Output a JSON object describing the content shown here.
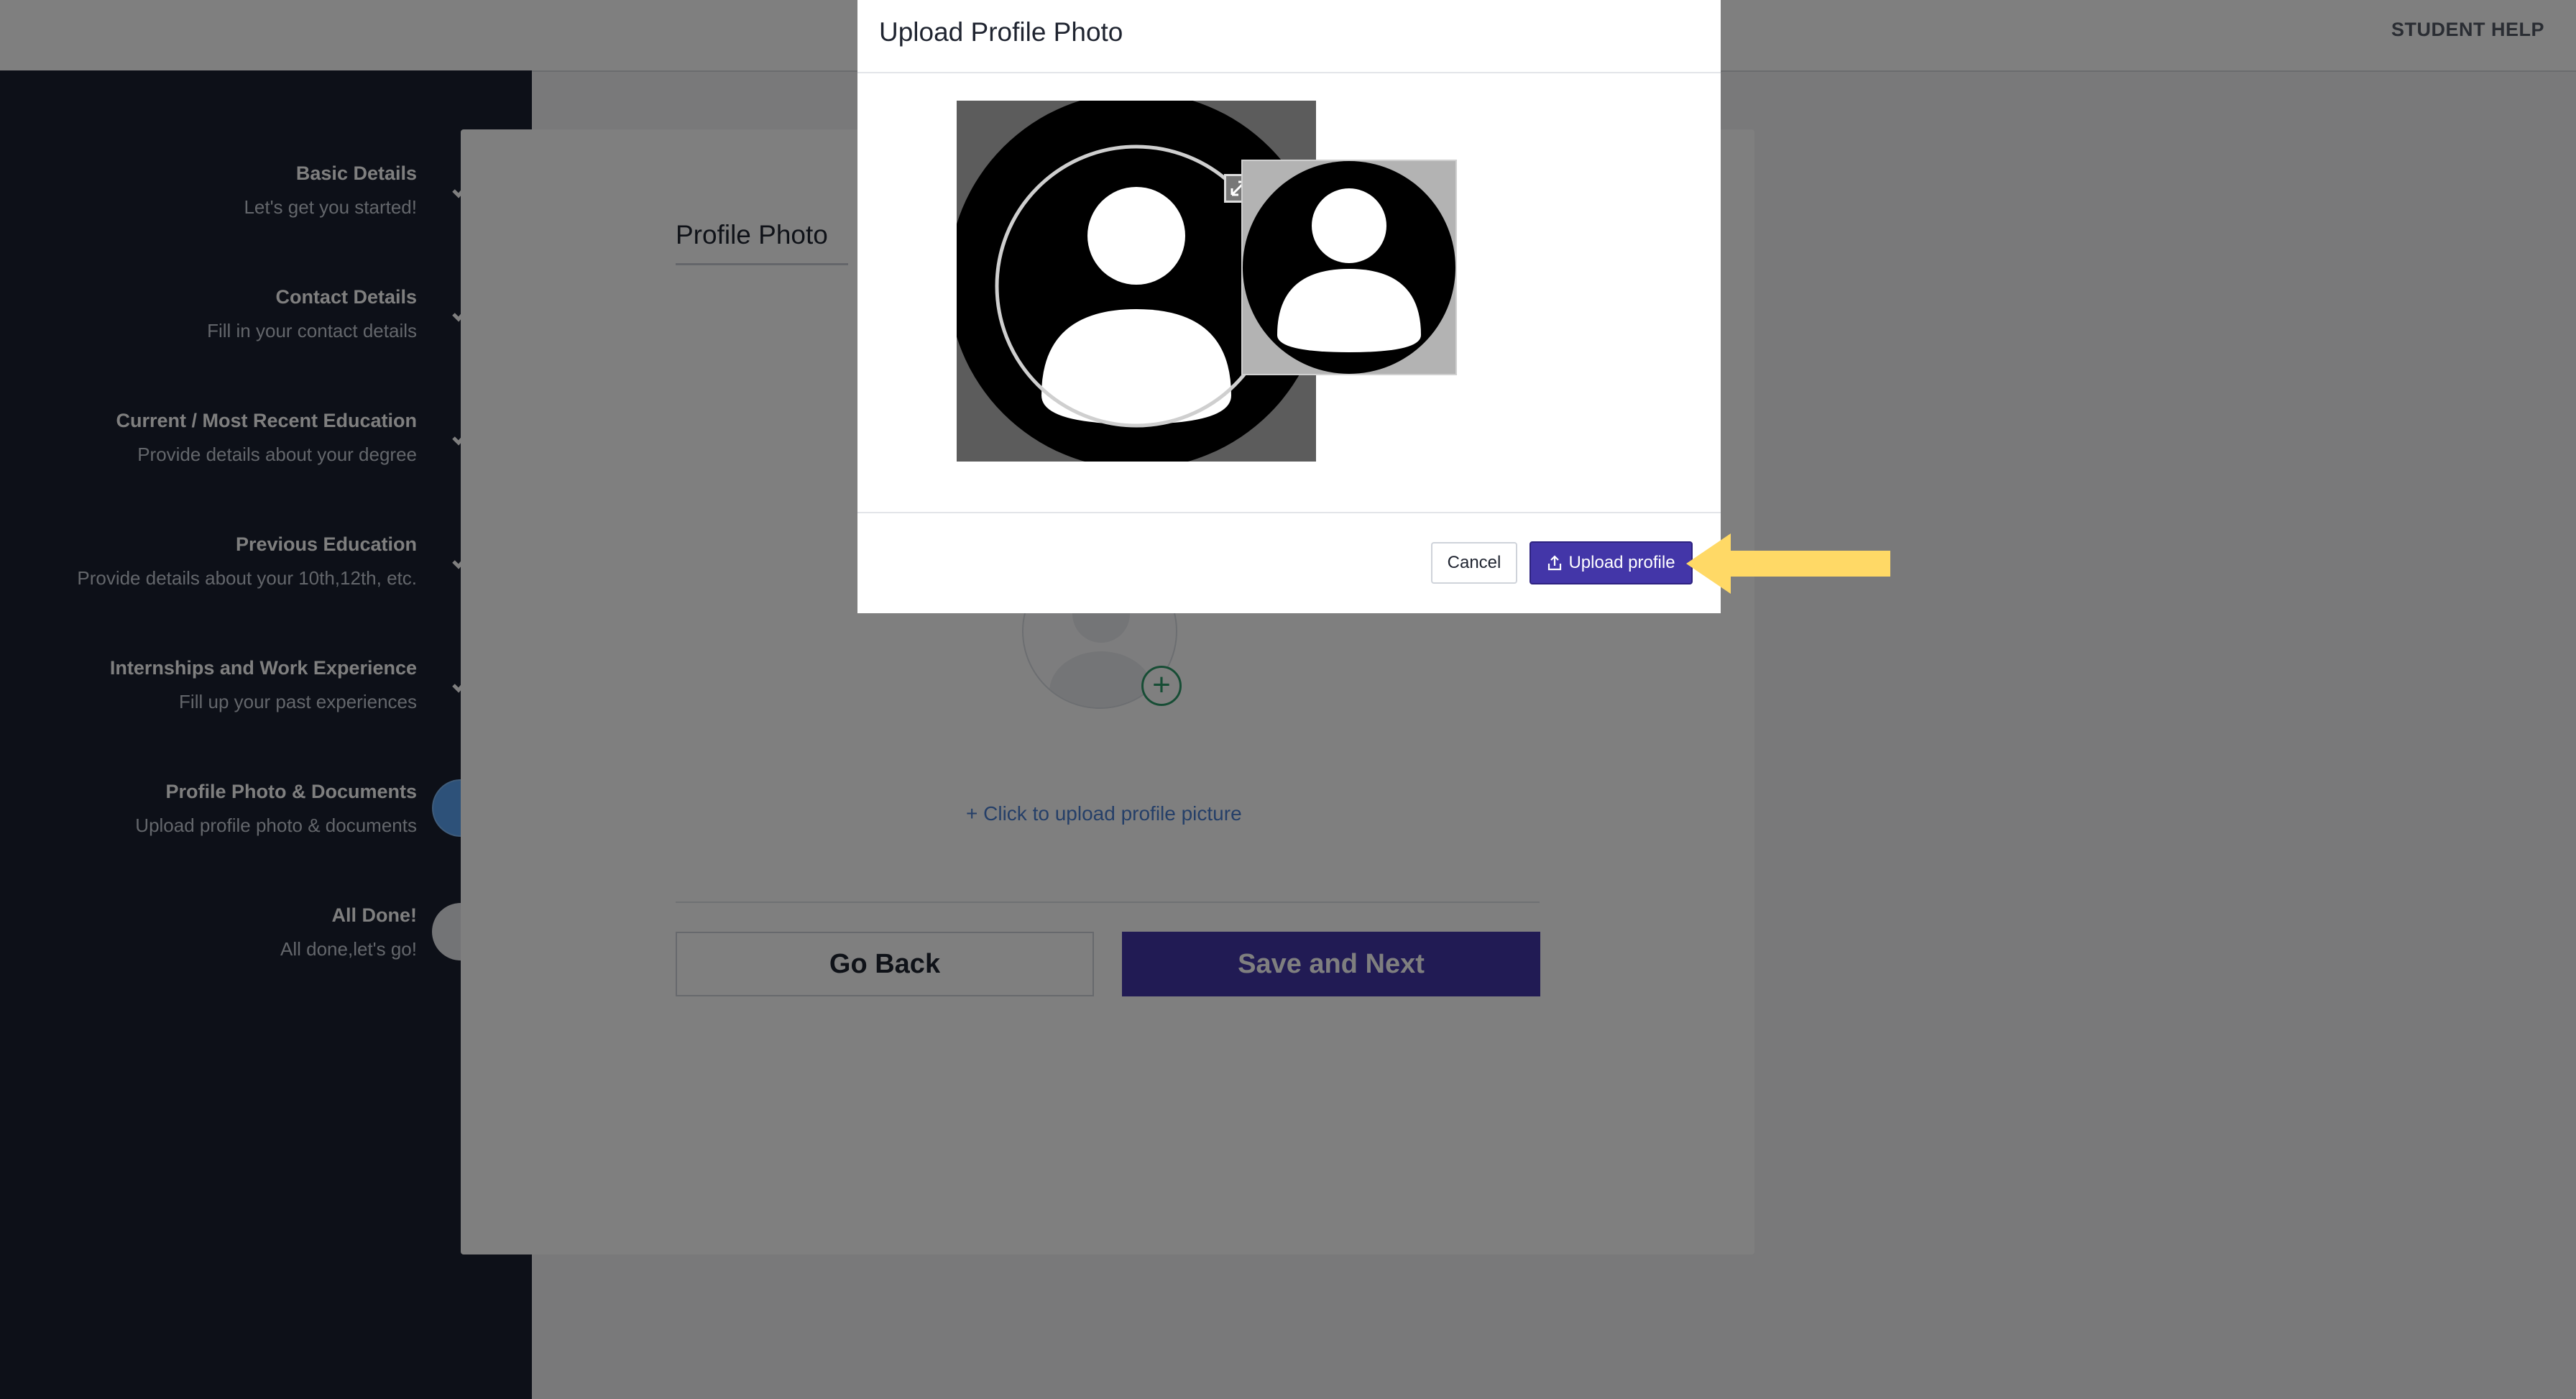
{
  "header": {
    "help_label": "STUDENT HELP"
  },
  "sidebar": {
    "steps": [
      {
        "title": "Basic Details",
        "subtitle": "Let's get you started!",
        "status": "done"
      },
      {
        "title": "Contact Details",
        "subtitle": "Fill in your contact details",
        "status": "done"
      },
      {
        "title": "Current / Most Recent Education",
        "subtitle": "Provide details about your degree",
        "status": "done"
      },
      {
        "title": "Previous Education",
        "subtitle": "Provide details about your 10th,12th, etc.",
        "status": "done"
      },
      {
        "title": "Internships and Work Experience",
        "subtitle": "Fill up your past experiences",
        "status": "done"
      },
      {
        "title": "Profile Photo & Documents",
        "subtitle": "Upload profile photo & documents",
        "status": "active"
      },
      {
        "title": "All Done!",
        "subtitle": "All done,let's go!",
        "status": "pending"
      }
    ]
  },
  "main": {
    "section_title": "Profile Photo",
    "upload_link": "+ Click to upload profile picture",
    "back_label": "Go Back",
    "next_label": "Save and Next"
  },
  "modal": {
    "title": "Upload Profile Photo",
    "cancel_label": "Cancel",
    "upload_label": "Upload profile"
  },
  "icons": {
    "step_done": "check-icon",
    "upload_button": "upload-icon",
    "crop_handle": "resize-icon",
    "annotation": "arrow-left-icon"
  },
  "colors": {
    "sidebar": "#1b2130",
    "primary": "#4336a8",
    "active_step": "#5aa3f2",
    "link": "#4a7fd1",
    "arrow": "#ffd966"
  }
}
